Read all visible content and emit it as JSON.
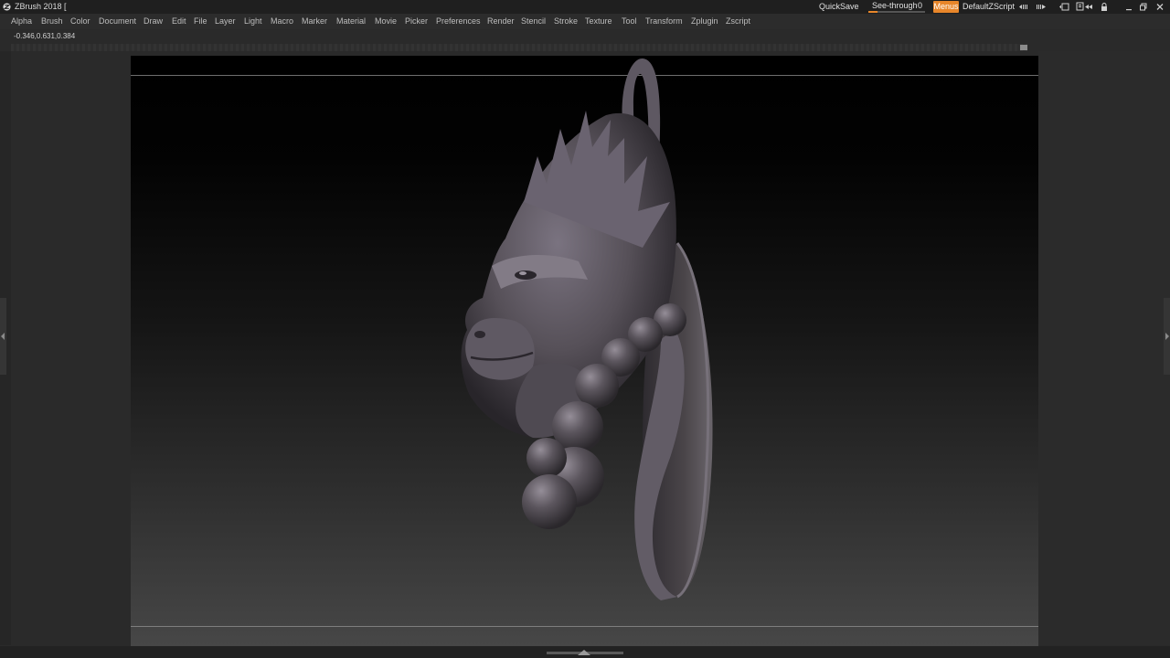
{
  "titlebar": {
    "title": "ZBrush 2018 [",
    "quicksave": "QuickSave",
    "see_through_label": "See-through",
    "see_through_value": "0",
    "menus": "Menus",
    "script": "DefaultZScript"
  },
  "menu": {
    "items": [
      "Alpha",
      "Brush",
      "Color",
      "Document",
      "Draw",
      "Edit",
      "File",
      "Layer",
      "Light",
      "Macro",
      "Marker",
      "Material",
      "Movie",
      "Picker",
      "Preferences",
      "Render",
      "Stencil",
      "Stroke",
      "Texture",
      "Tool",
      "Transform",
      "Zplugin",
      "Zscript"
    ]
  },
  "coords": "-0.346,0.631,0.384",
  "colors": {
    "accent": "#e8862a",
    "background": "#2a2a2a",
    "sculpt": "#5c5560"
  },
  "icons": [
    "zbrush-logo-icon",
    "arrow-left-right-icon",
    "arrow-right-icon",
    "layout-icon",
    "document-icon",
    "arrows-icon",
    "lock-icon",
    "minimize-icon",
    "restore-icon",
    "close-icon"
  ]
}
